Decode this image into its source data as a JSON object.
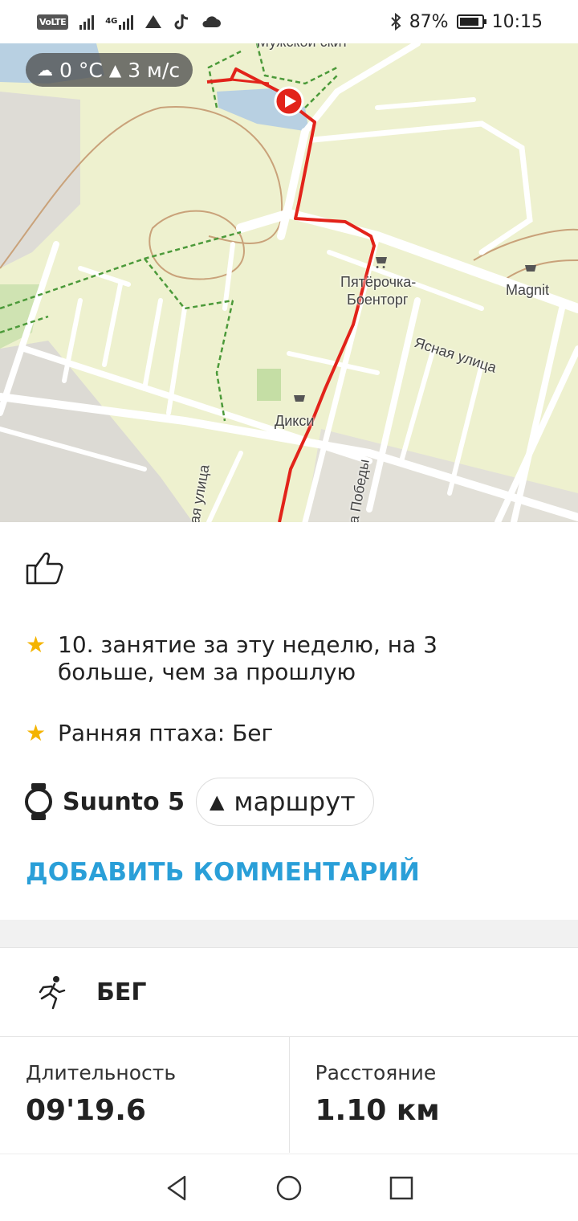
{
  "status_bar": {
    "volte": "VoLTE",
    "net_4g": "4G",
    "battery_text": "87%",
    "battery_level": 0.87,
    "time": "10:15"
  },
  "map": {
    "weather_temp": "0 °C",
    "weather_wind": "3 м/с",
    "labels": {
      "top": "Мужской скит",
      "pyaterochka_1": "Пятёрочка-",
      "pyaterochka_2": "Боенторг",
      "magnit": "Magnit",
      "yasnaya": "Ясная улица",
      "diksi": "Дикси",
      "street_left": "ая улица",
      "pobedy": "а Победы"
    }
  },
  "card": {
    "achievements": [
      "10. занятие за эту неделю, на 3 больше, чем за прошлую",
      "Ранняя птаха: Бег"
    ],
    "device": "Suunto 5",
    "route_chip": "маршрут",
    "add_comment": "ДОБАВИТЬ КОММЕНТАРИЙ"
  },
  "sport": {
    "label": "БЕГ"
  },
  "stats": {
    "duration_label": "Длительность",
    "duration_value": "09'19.6",
    "distance_label": "Расстояние",
    "distance_value": "1.10 км"
  },
  "colors": {
    "accent": "#2a9fd8",
    "route": "#e2231a",
    "star": "#f4b400",
    "map_bg": "#eef1cf"
  }
}
